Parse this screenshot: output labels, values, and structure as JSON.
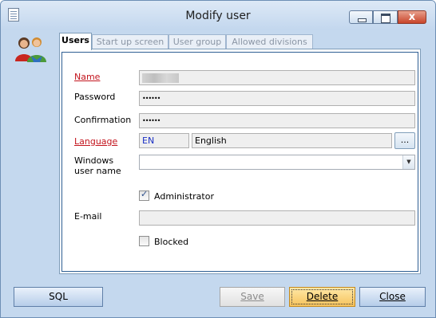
{
  "window": {
    "title": "Modify user"
  },
  "title_controls": {
    "minimize": "minimize",
    "maximize": "maximize",
    "close": "x"
  },
  "tabs": [
    {
      "label": "Users",
      "active": true
    },
    {
      "label": "Start up screen",
      "active": false
    },
    {
      "label": "User group",
      "active": false
    },
    {
      "label": "Allowed divisions",
      "active": false
    }
  ],
  "form": {
    "name_label": "Name",
    "password_label": "Password",
    "password_value": "••••••",
    "confirmation_label": "Confirmation",
    "confirmation_value": "••••••",
    "language_label": "Language",
    "language_code": "EN",
    "language_name": "English",
    "language_browse": "...",
    "windows_user_label_1": "Windows",
    "windows_user_label_2": "user name",
    "windows_user_value": "",
    "administrator_label": "Administrator",
    "administrator_checked": true,
    "email_label": "E-mail",
    "email_value": "",
    "blocked_label": "Blocked",
    "blocked_checked": false
  },
  "footer": {
    "sql": "SQL",
    "save": "Save",
    "delete": "Delete",
    "close": "Close"
  },
  "icons": {
    "app": "document-icon",
    "users": "users-icon",
    "dropdown": "chevron-down-icon",
    "check": "check-icon"
  },
  "colors": {
    "required_label": "#c3141d",
    "language_code": "#1a2fc4",
    "window_background": "#c4d8ee",
    "focused_button": "#f6c35d"
  }
}
